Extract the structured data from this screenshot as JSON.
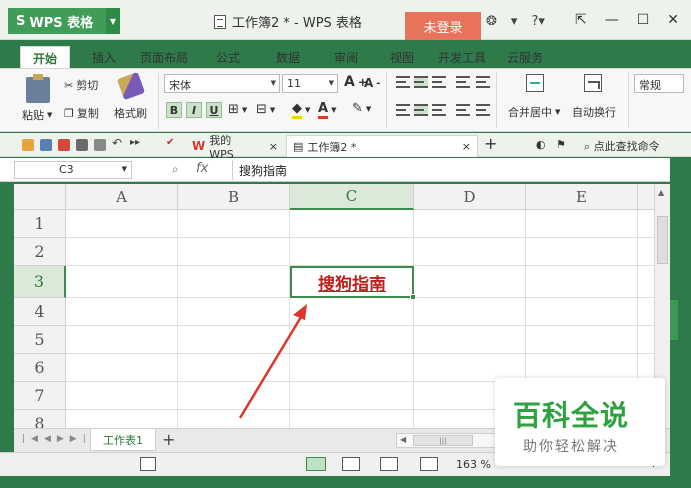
{
  "titlebar": {
    "app_name": "WPS 表格",
    "doc_title": "工作簿2 * - WPS 表格",
    "login_label": "未登录",
    "icons": [
      "skin-icon",
      "shirt-icon",
      "help-icon",
      "minimize-to-tray-icon"
    ],
    "help_label": "?"
  },
  "tabs": [
    "开始",
    "插入",
    "页面布局",
    "公式",
    "数据",
    "审阅",
    "视图",
    "开发工具",
    "云服务"
  ],
  "ribbon": {
    "paste": "粘贴",
    "cut": "剪切",
    "copy": "复制",
    "format_painter": "格式刷",
    "font_name": "宋体",
    "font_size": "11",
    "bold": "B",
    "italic": "I",
    "underline": "U",
    "font_grow": "A",
    "font_shrink": "A",
    "merge_center": "合并居中",
    "wrap_text": "自动换行",
    "style_normal": "常规"
  },
  "qat": {
    "doc_tabs": [
      {
        "label": "我的WPS",
        "close": "×"
      },
      {
        "label": "工作簿2 *",
        "close": "×"
      }
    ],
    "add_tab": "+",
    "search_label": "点此查找命令"
  },
  "formula_bar": {
    "name_box": "C3",
    "fx": "fx",
    "value": "搜狗指南"
  },
  "grid": {
    "columns": [
      "A",
      "B",
      "C",
      "D",
      "E"
    ],
    "rows": [
      "1",
      "2",
      "3",
      "4",
      "5",
      "6",
      "7",
      "8"
    ],
    "selected_column": "C",
    "selected_row": "3",
    "active_cell_text": "搜狗指南"
  },
  "sheets": {
    "tabs": [
      "工作表1"
    ],
    "add": "+"
  },
  "statusbar": {
    "zoom": "163 %"
  },
  "watermark": {
    "title": "百科全说",
    "subtitle": "助你轻松解决"
  },
  "colors": {
    "accent_green": "#3a8c4a",
    "login_orange": "#e8735a",
    "cell_text_red": "#c0201a",
    "arrow_red": "#e0352b"
  }
}
